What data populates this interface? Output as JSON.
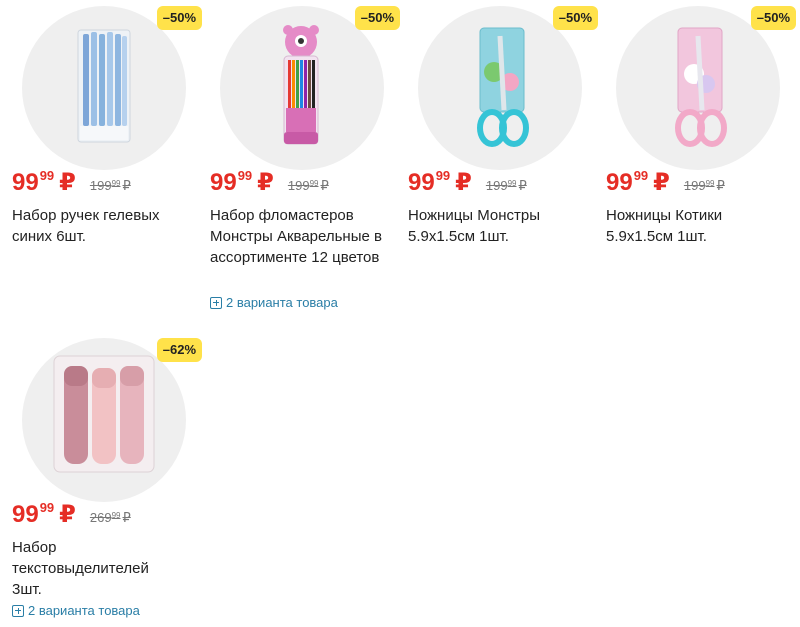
{
  "products": [
    {
      "discount": "–50%",
      "price_int": "99",
      "price_frac": "99",
      "currency": "₽",
      "old_int": "199",
      "old_frac": "99",
      "old_currency": "₽",
      "title": "Набор ручек гелевых синих 6шт.",
      "variants": ""
    },
    {
      "discount": "–50%",
      "price_int": "99",
      "price_frac": "99",
      "currency": "₽",
      "old_int": "199",
      "old_frac": "99",
      "old_currency": "₽",
      "title": "Набор фломастеров Монстры Акварельные в ассортименте 12 цветов",
      "variants": "2 варианта товара"
    },
    {
      "discount": "–50%",
      "price_int": "99",
      "price_frac": "99",
      "currency": "₽",
      "old_int": "199",
      "old_frac": "99",
      "old_currency": "₽",
      "title": "Ножницы Монстры 5.9x1.5см 1шт.",
      "variants": ""
    },
    {
      "discount": "–50%",
      "price_int": "99",
      "price_frac": "99",
      "currency": "₽",
      "old_int": "199",
      "old_frac": "99",
      "old_currency": "₽",
      "title": "Ножницы Котики 5.9x1.5см 1шт.",
      "variants": ""
    },
    {
      "discount": "–62%",
      "price_int": "99",
      "price_frac": "99",
      "currency": "₽",
      "old_int": "269",
      "old_frac": "99",
      "old_currency": "₽",
      "title": "Набор текстовыделителей 3шт.",
      "variants": "2 варианта товара"
    }
  ],
  "colors": {
    "price": "#e52d25",
    "badge": "#ffe24a",
    "link": "#2a7ea6"
  }
}
